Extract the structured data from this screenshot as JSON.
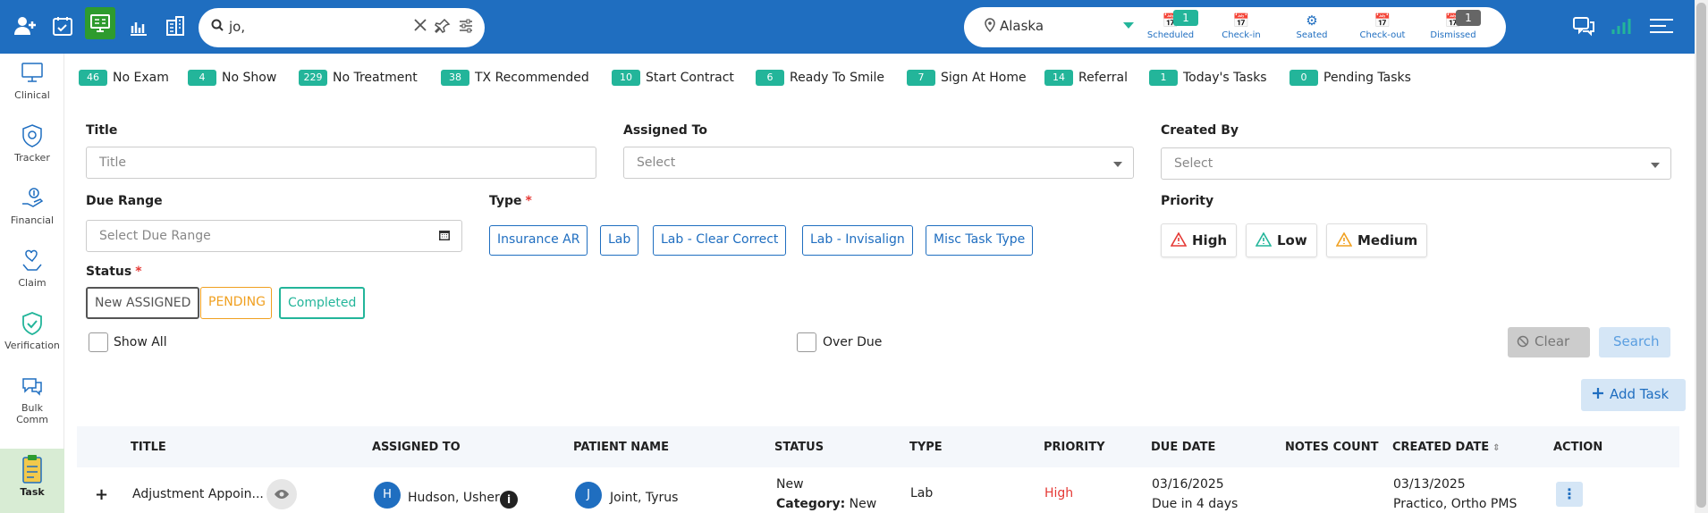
{
  "topbar": {
    "search": {
      "value": "jo,"
    },
    "location": "Alaska",
    "stages": [
      {
        "label": "Scheduled",
        "count": "1"
      },
      {
        "label": "Check-in",
        "count": ""
      },
      {
        "label": "Seated",
        "count": ""
      },
      {
        "label": "Check-out",
        "count": ""
      },
      {
        "label": "Dismissed",
        "count": "1"
      }
    ],
    "accent": "#23b59a",
    "bar_color": "#1f6ec0"
  },
  "sidebar": {
    "items": [
      {
        "label": "Clinical",
        "icon": "monitor-icon"
      },
      {
        "label": "Tracker",
        "icon": "shield-icon"
      },
      {
        "label": "Financial",
        "icon": "hand-dollar-icon"
      },
      {
        "label": "Claim",
        "icon": "hand-heart-icon"
      },
      {
        "label": "Verification",
        "icon": "check-shield-icon"
      },
      {
        "label": "Bulk Comm",
        "icon": "chat-icon"
      },
      {
        "label": "Task",
        "icon": "clipboard-icon"
      }
    ]
  },
  "tags": [
    {
      "count": "46",
      "label": "No Exam"
    },
    {
      "count": "4",
      "label": "No Show"
    },
    {
      "count": "229",
      "label": "No Treatment"
    },
    {
      "count": "38",
      "label": "TX Recommended"
    },
    {
      "count": "10",
      "label": "Start Contract"
    },
    {
      "count": "6",
      "label": "Ready To Smile"
    },
    {
      "count": "7",
      "label": "Sign At Home"
    },
    {
      "count": "14",
      "label": "Referral"
    },
    {
      "count": "1",
      "label": "Today's Tasks"
    },
    {
      "count": "0",
      "label": "Pending Tasks"
    }
  ],
  "filters": {
    "title_label": "Title",
    "title_placeholder": "Title",
    "assigned_label": "Assigned To",
    "assigned_placeholder": "Select",
    "created_label": "Created By",
    "created_placeholder": "Select",
    "due_label": "Due Range",
    "due_placeholder": "Select Due Range",
    "type_label": "Type",
    "type_req": "*",
    "types": [
      "Insurance AR",
      "Lab",
      "Lab - Clear Correct",
      "Lab - Invisalign",
      "Misc Task Type"
    ],
    "priority_label": "Priority",
    "priorities": [
      {
        "label": "High",
        "color": "#e53935"
      },
      {
        "label": "Low",
        "color": "#23b59a"
      },
      {
        "label": "Medium",
        "color": "#f0a020"
      }
    ],
    "status_label": "Status",
    "status_req": "*",
    "statuses": [
      {
        "label": "New ASSIGNED",
        "color": "#555"
      },
      {
        "label": "PENDING",
        "color": "#f0a020"
      },
      {
        "label": "Completed",
        "color": "#23b59a"
      }
    ],
    "show_all": "Show All",
    "over_due": "Over Due",
    "clear": "Clear",
    "search": "Search"
  },
  "add_task": "Add Task",
  "table": {
    "headers": [
      "TITLE",
      "ASSIGNED TO",
      "PATIENT NAME",
      "STATUS",
      "TYPE",
      "PRIORITY",
      "DUE DATE",
      "NOTES COUNT",
      "CREATED DATE",
      "ACTION"
    ],
    "rows": [
      {
        "expand": "+",
        "title": "Adjustment Appoin...",
        "assigned_initial": "H",
        "assigned": "Hudson, Usher",
        "patient_initial": "J",
        "patient": "Joint, Tyrus",
        "status": "New",
        "category_label": "Category:",
        "category": "New",
        "type": "Lab",
        "priority": "High",
        "due_date": "03/16/2025",
        "due_note": "Due in 4 days",
        "created_date": "03/13/2025",
        "created_by": "Practico, Ortho PMS"
      }
    ]
  }
}
